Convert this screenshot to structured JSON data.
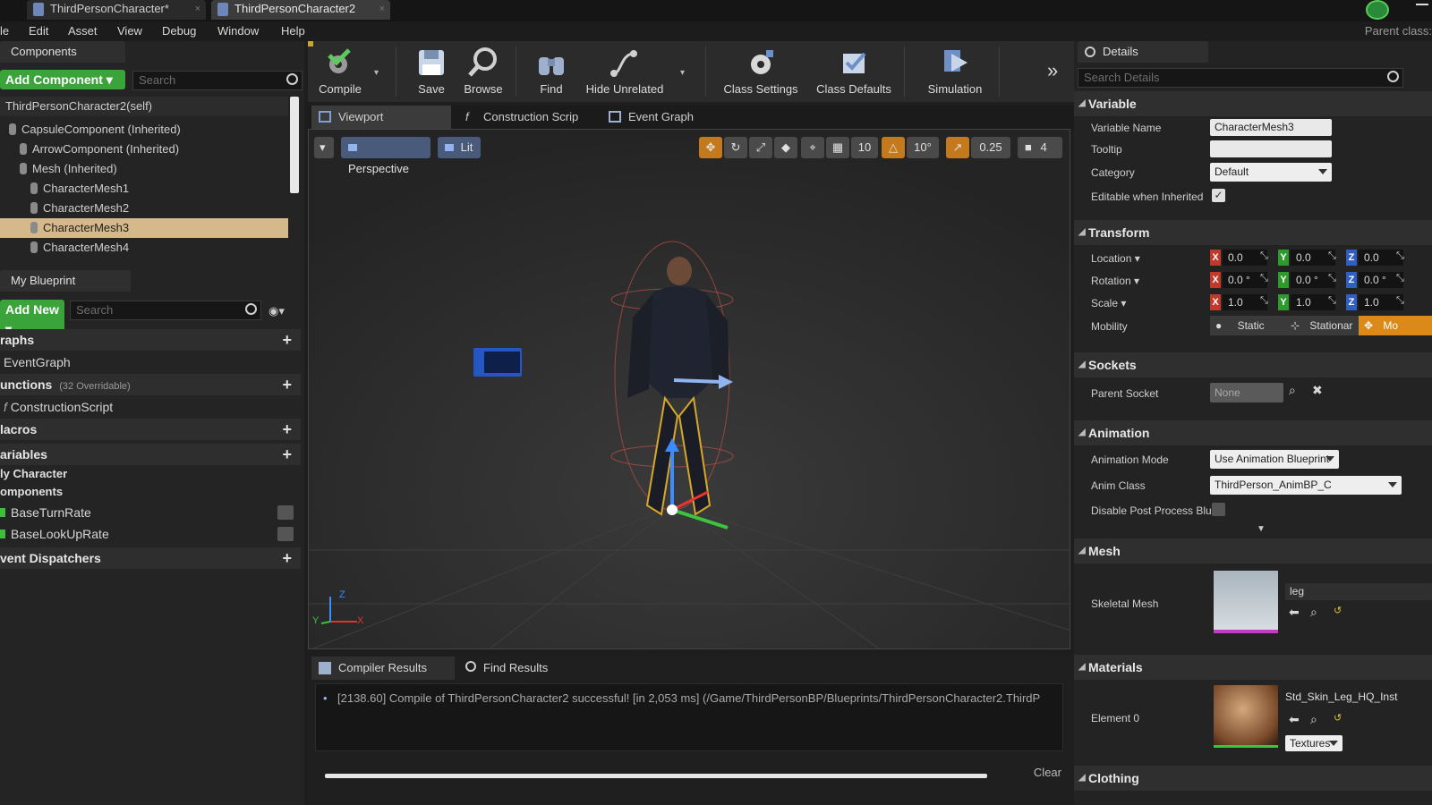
{
  "window": {
    "tabs": [
      {
        "label": "ThirdPersonCharacter*"
      },
      {
        "label": "ThirdPersonCharacter2"
      }
    ],
    "menu": [
      "le",
      "Edit",
      "Asset",
      "View",
      "Debug",
      "Window",
      "Help"
    ],
    "parent_class_label": "Parent class:"
  },
  "components": {
    "header": "Components",
    "add_button": "Add Component",
    "search_placeholder": "Search",
    "self_label": "ThirdPersonCharacter2(self)",
    "tree": [
      {
        "label": "CapsuleComponent (Inherited)",
        "indent": 1
      },
      {
        "label": "ArrowComponent (Inherited)",
        "indent": 2
      },
      {
        "label": "Mesh (Inherited)",
        "indent": 2
      },
      {
        "label": "CharacterMesh1",
        "indent": 3
      },
      {
        "label": "CharacterMesh2",
        "indent": 3
      },
      {
        "label": "CharacterMesh3",
        "indent": 3,
        "selected": true
      },
      {
        "label": "CharacterMesh4",
        "indent": 3
      }
    ]
  },
  "my_blueprint": {
    "header": "My Blueprint",
    "add_button": "Add New",
    "search_placeholder": "Search",
    "graphs_label": "raphs",
    "graph_item": "EventGraph",
    "functions_label": "unctions",
    "functions_overridable": "(32 Overridable)",
    "function_item": "ConstructionScript",
    "macros_label": "lacros",
    "variables_label": "ariables",
    "var_category_1": "ly Character",
    "var_category_2": "omponents",
    "var_items": [
      "BaseTurnRate",
      "BaseLookUpRate"
    ],
    "dispatchers_label": "vent Dispatchers"
  },
  "toolbar": {
    "buttons": [
      "Compile",
      "Save",
      "Browse",
      "Find",
      "Hide Unrelated",
      "Class Settings",
      "Class Defaults",
      "Simulation"
    ]
  },
  "editor_tabs": [
    "Viewport",
    "Construction Scrip",
    "Event Graph"
  ],
  "viewport": {
    "perspective": "Perspective",
    "lit": "Lit",
    "grid_snap": "10",
    "rot_snap": "10°",
    "scale_snap": "0.25",
    "camera_speed": "4"
  },
  "results": {
    "tabs": [
      "Compiler Results",
      "Find Results"
    ],
    "log": "[2138.60] Compile of ThirdPersonCharacter2 successful! [in 2,053 ms] (/Game/ThirdPersonBP/Blueprints/ThirdPersonCharacter2.ThirdP",
    "clear": "Clear"
  },
  "details": {
    "header": "Details",
    "search_placeholder": "Search Details",
    "variable": {
      "section": "Variable",
      "name_label": "Variable Name",
      "name_value": "CharacterMesh3",
      "tooltip_label": "Tooltip",
      "tooltip_value": "",
      "category_label": "Category",
      "category_value": "Default",
      "editable_label": "Editable when Inherited"
    },
    "transform": {
      "section": "Transform",
      "location_label": "Location",
      "rotation_label": "Rotation",
      "scale_label": "Scale",
      "location": [
        "0.0",
        "0.0",
        "0.0"
      ],
      "rotation": [
        "0.0 °",
        "0.0 °",
        "0.0 °"
      ],
      "scale": [
        "1.0",
        "1.0",
        "1.0"
      ],
      "axes": [
        "X",
        "Y",
        "Z"
      ],
      "mobility_label": "Mobility",
      "mobility_options": [
        "Static",
        "Stationar",
        "Mo"
      ]
    },
    "sockets": {
      "section": "Sockets",
      "parent_label": "Parent Socket",
      "parent_value": "None"
    },
    "animation": {
      "section": "Animation",
      "mode_label": "Animation Mode",
      "mode_value": "Use Animation Blueprint",
      "class_label": "Anim Class",
      "class_value": "ThirdPerson_AnimBP_C",
      "disable_label": "Disable Post Process Blue"
    },
    "mesh": {
      "section": "Mesh",
      "skeletal_label": "Skeletal Mesh",
      "skeletal_value": "leg"
    },
    "materials": {
      "section": "Materials",
      "element_label": "Element 0",
      "element_value": "Std_Skin_Leg_HQ_Inst",
      "textures": "Textures"
    },
    "clothing": {
      "section": "Clothing"
    }
  },
  "colors": {
    "accent_green": "#3aa33a",
    "selection": "#d6b98a",
    "snap_orange": "#c47a1c"
  }
}
